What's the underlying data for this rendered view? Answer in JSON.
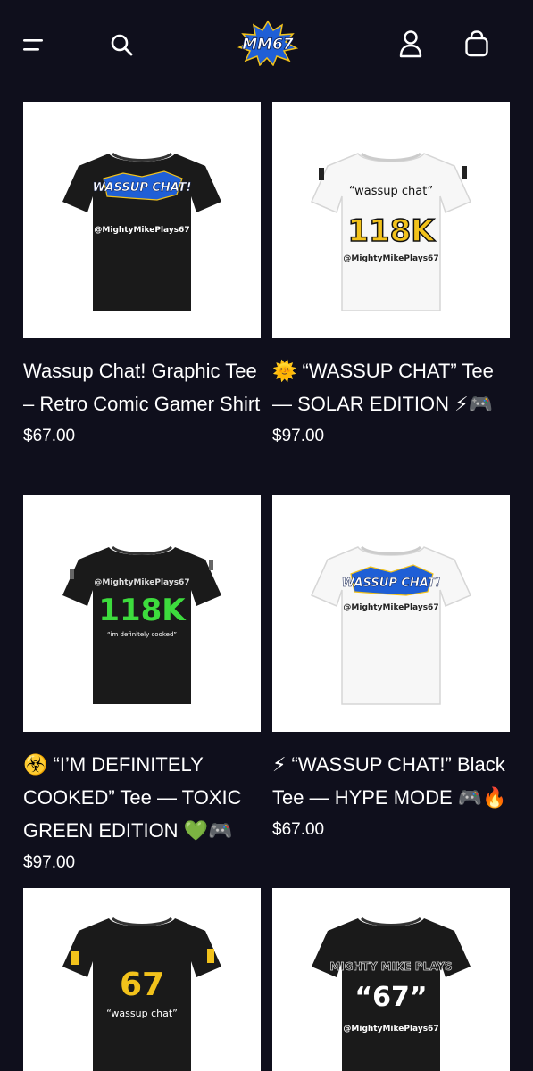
{
  "header": {
    "menu_icon": "menu-icon",
    "search_icon": "search-icon",
    "logo_text": "MM67",
    "account_icon": "account-icon",
    "cart_icon": "cart-icon"
  },
  "products": [
    {
      "title": "Wassup Chat! Graphic Tee – Retro Comic Gamer Shirt",
      "price": "$67.00",
      "shirt_color": "black",
      "print_lines": [
        "WASSUP CHAT!",
        "@MightyMikePlays67"
      ]
    },
    {
      "title": "🌞 “WASSUP CHAT” Tee — SOLAR EDITION ⚡🎮",
      "price": "$97.00",
      "shirt_color": "white",
      "print_lines": [
        "“wassup chat”",
        "118K",
        "@MightyMikePlays67"
      ]
    },
    {
      "title": "☣️ “I’M DEFINITELY COOKED” Tee — TOXIC GREEN EDITION 💚🎮",
      "price": "$97.00",
      "shirt_color": "black",
      "print_lines": [
        "@MightyMikePlays67",
        "118K",
        "“im definitely cooked”"
      ]
    },
    {
      "title": "⚡ “WASSUP CHAT!” Black Tee — HYPE MODE 🎮🔥",
      "price": "$67.00",
      "shirt_color": "white",
      "print_lines": [
        "WASSUP CHAT!",
        "@MightyMikePlays67"
      ]
    },
    {
      "title": "",
      "price": "",
      "shirt_color": "black",
      "print_lines": [
        "67",
        "“wassup chat”"
      ]
    },
    {
      "title": "",
      "price": "",
      "shirt_color": "black",
      "print_lines": [
        "MIGHTY MIKE PLAYS",
        "“67”",
        "@MightyMikePlays67"
      ]
    }
  ],
  "colors": {
    "background": "#0f0f1c",
    "text": "#ffffff",
    "accent_yellow": "#f2c21b",
    "accent_green": "#3ddc3d",
    "comic_blue": "#1f5fd6"
  }
}
